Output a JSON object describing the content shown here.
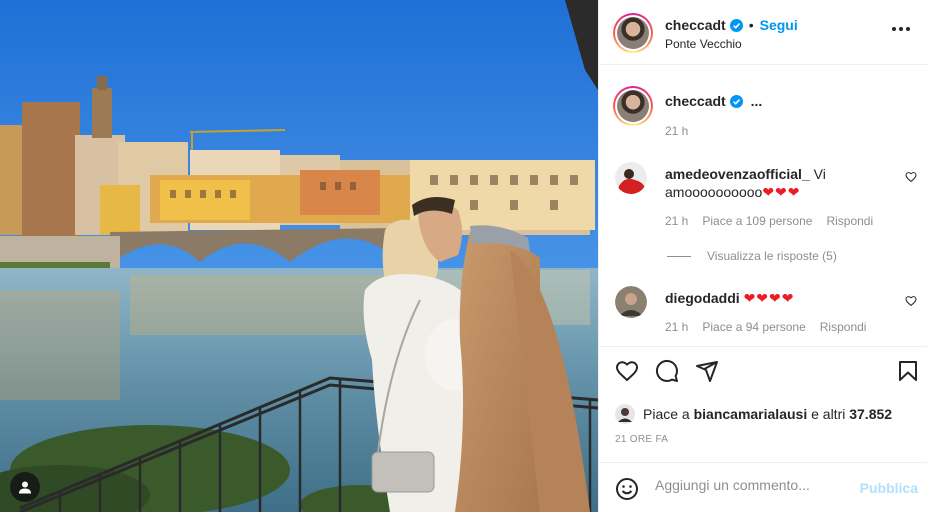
{
  "post": {
    "username": "checcadt",
    "follow_label": "Segui",
    "separator": "•",
    "location": "Ponte Vecchio"
  },
  "caption": {
    "username": "checcadt",
    "text": "...",
    "time": "21 h"
  },
  "comments": [
    {
      "username": "amedeovenzaofficial_",
      "text": "Vi amoooooooooo",
      "hearts": "❤❤❤",
      "time": "21 h",
      "likes": "Piace a 109 persone",
      "reply": "Rispondi"
    },
    {
      "username": "diegodaddi",
      "text": "",
      "hearts": "❤❤❤❤",
      "time": "21 h",
      "likes": "Piace a 94 persone",
      "reply": "Rispondi"
    }
  ],
  "view_replies": "Visualizza le risposte (5)",
  "likes": {
    "prefix": "Piace a ",
    "user": "biancamarialausi",
    "suffix": " e altri ",
    "count": "37.852"
  },
  "time_ago": "21 ORE FA",
  "comment_input": {
    "placeholder": "Aggiungi un commento...",
    "publish_label": "Pubblica"
  },
  "icons": {
    "verified": "verified-badge-icon",
    "more": "more-options-icon",
    "like": "heart-icon",
    "comment": "comment-icon",
    "share": "share-icon",
    "save": "bookmark-icon",
    "emoji": "emoji-icon",
    "tag": "tagged-user-icon"
  },
  "colors": {
    "accent": "#0095f6",
    "publish_disabled": "#b2dffc",
    "heart_emoji": "#ed1c24",
    "muted_text": "#8e8e8e"
  }
}
